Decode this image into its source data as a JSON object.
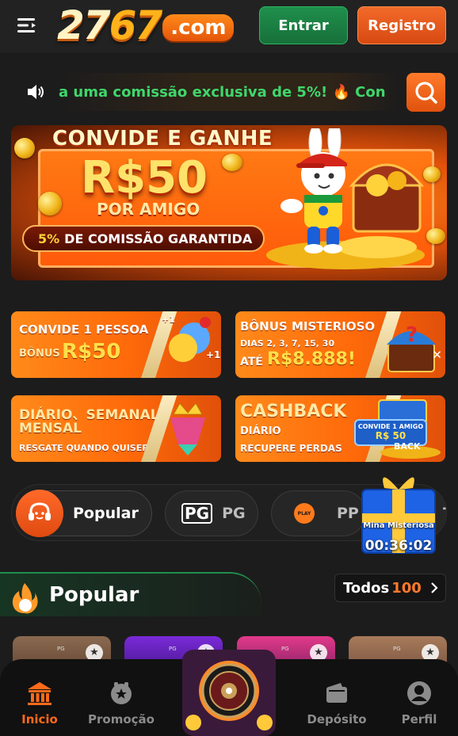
{
  "header": {
    "logo_num_a": "27",
    "logo_num_b": "67",
    "logo_com": ".com",
    "login_label": "Entrar",
    "register_label": "Registro"
  },
  "marquee": {
    "text": "a uma comissão exclusiva de 5%! 🔥 Con"
  },
  "banner": {
    "title": "CONVIDE E GANHE",
    "amount": "R$50",
    "subtitle": "POR AMIGO",
    "pill_pct": "5%",
    "pill_text": "DE COMISSÃO GARANTIDA"
  },
  "promos": {
    "invite": {
      "line1": "CONVIDE 1 PESSOA",
      "bonus_label": "BÔNUS",
      "bonus_value": "R$50",
      "plus1": "+1",
      "plus2": "+1"
    },
    "mystery": {
      "line1": "BÔNUS MISTERIOSO",
      "line2": "DIAS 2, 3, 7, 15, 30",
      "ate": "ATÉ",
      "value": "R$8.888!"
    },
    "daily": {
      "line1": "DIÁRIO、SEMANAL",
      "line2": "MENSAL",
      "line3": "RESGATE QUANDO QUISER"
    },
    "cashback": {
      "line1": "CASHBACK",
      "line2": "DIÁRIO",
      "line3": "RECUPERE PERDAS",
      "badge1": "CONVIDE 1 AMIGO",
      "badge2": "R$ 50",
      "back": "BACK"
    },
    "close_glyph": "✕"
  },
  "providers": {
    "tabs": [
      {
        "label": "Popular"
      },
      {
        "label": "PG",
        "logo": "PG"
      },
      {
        "label": "PP",
        "logo": "PLAY"
      },
      {
        "label": "Ta"
      }
    ]
  },
  "mystery_box": {
    "label": "Mina Misteriosa",
    "timer": "00:36:02"
  },
  "popular": {
    "title": "Popular",
    "todos_label": "Todos",
    "todos_count": "100",
    "thumb_tags": [
      "PG",
      "PG",
      "PG",
      "PG"
    ]
  },
  "bottom_nav": {
    "items": [
      {
        "label": "Inicio",
        "icon": "bank-icon"
      },
      {
        "label": "Promoção",
        "icon": "gift-bell-icon"
      },
      {
        "label": "Depósito",
        "icon": "wallet-icon"
      },
      {
        "label": "Perfil",
        "icon": "user-icon"
      }
    ]
  },
  "colors": {
    "accent": "#ff6a1a",
    "green": "#1f8f4c",
    "marquee_text": "#3fd76b",
    "background": "#1c1c1c"
  }
}
